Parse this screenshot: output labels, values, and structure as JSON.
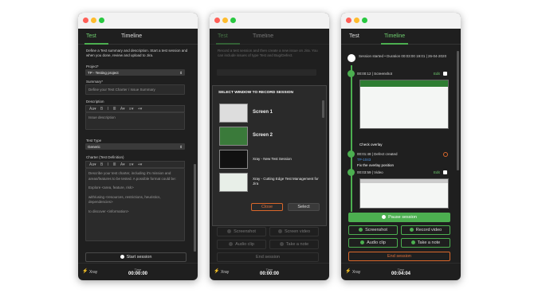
{
  "window1": {
    "tab_test": "Test",
    "tab_timeline": "Timeline",
    "intro": "Define a Test summary and description. Start a test session and when you done, review and upload to Jira.",
    "project_label": "Project*",
    "project_value": "TP - Testing project",
    "summary_label": "Summary*",
    "summary_placeholder": "Define your Test Charter / Issue Summary",
    "description_label": "Description",
    "format_bar": "Aa▾ B I ≣ A▾ ≡▾ +▾",
    "description_placeholder": "Issue description",
    "testtype_label": "Test Type",
    "testtype_value": "Generic",
    "charter_label": "Charter (Test Definition)",
    "charter_text1": "Describe your test charter, including it's mission and areas/features to be tested. A possible format could be:",
    "charter_text2": "Explore <area, feature, risk>",
    "charter_text3": "with/using <resources, restrictions, heuristics, dependencies>",
    "charter_text4": "to discover <information>",
    "start_button": "Start session",
    "logo": "Xray",
    "time_label": "Time",
    "time_value": "00:00:00"
  },
  "window2": {
    "tab_test": "Test",
    "tab_timeline": "Timeline",
    "intro": "Record a test session and then create a new issue on Jira. You can include issues of type Test and Bug/Defect.",
    "dialog_title": "SELECT WINDOW TO RECORD SESSION",
    "options": [
      "Screen 1",
      "Screen 2",
      "Xray - New Test Session",
      "Xray - Cutting Edge Test Management for Jira"
    ],
    "close_button": "Close",
    "select_button": "Select",
    "screenshot": "Screenshot",
    "screen_video": "Screen video",
    "audio_clip": "Audio clip",
    "take_note": "Take a note",
    "end_session": "End session",
    "logo": "Xray",
    "time_label": "Time",
    "time_value": "00:00:00"
  },
  "window3": {
    "tab_test": "Test",
    "tab_timeline": "Timeline",
    "session_started": "Session started • Duration 00:03:00 19:01 | 26-04-2020",
    "entry1": "00:00:12 | Screenshot",
    "entry1_edit": "Edit",
    "caption1": "Check overlay",
    "entry2": "00:01:48 | Defect created",
    "entry2_id": "TP-1043",
    "entry2_title": "Fix the overlay position",
    "entry3": "00:03:59 | Video",
    "entry3_edit": "Edit",
    "pause_button": "Pause session",
    "screenshot": "Screenshot",
    "record_video": "Record video",
    "audio_clip": "Audio clip",
    "take_note": "Take a note",
    "end_session": "End session",
    "logo": "Xray",
    "time_label": "Time",
    "time_value": "00:04:04"
  },
  "colors": {
    "accent": "#4caf50",
    "danger": "#d9672b",
    "window_bg": "#1f1f1f"
  }
}
